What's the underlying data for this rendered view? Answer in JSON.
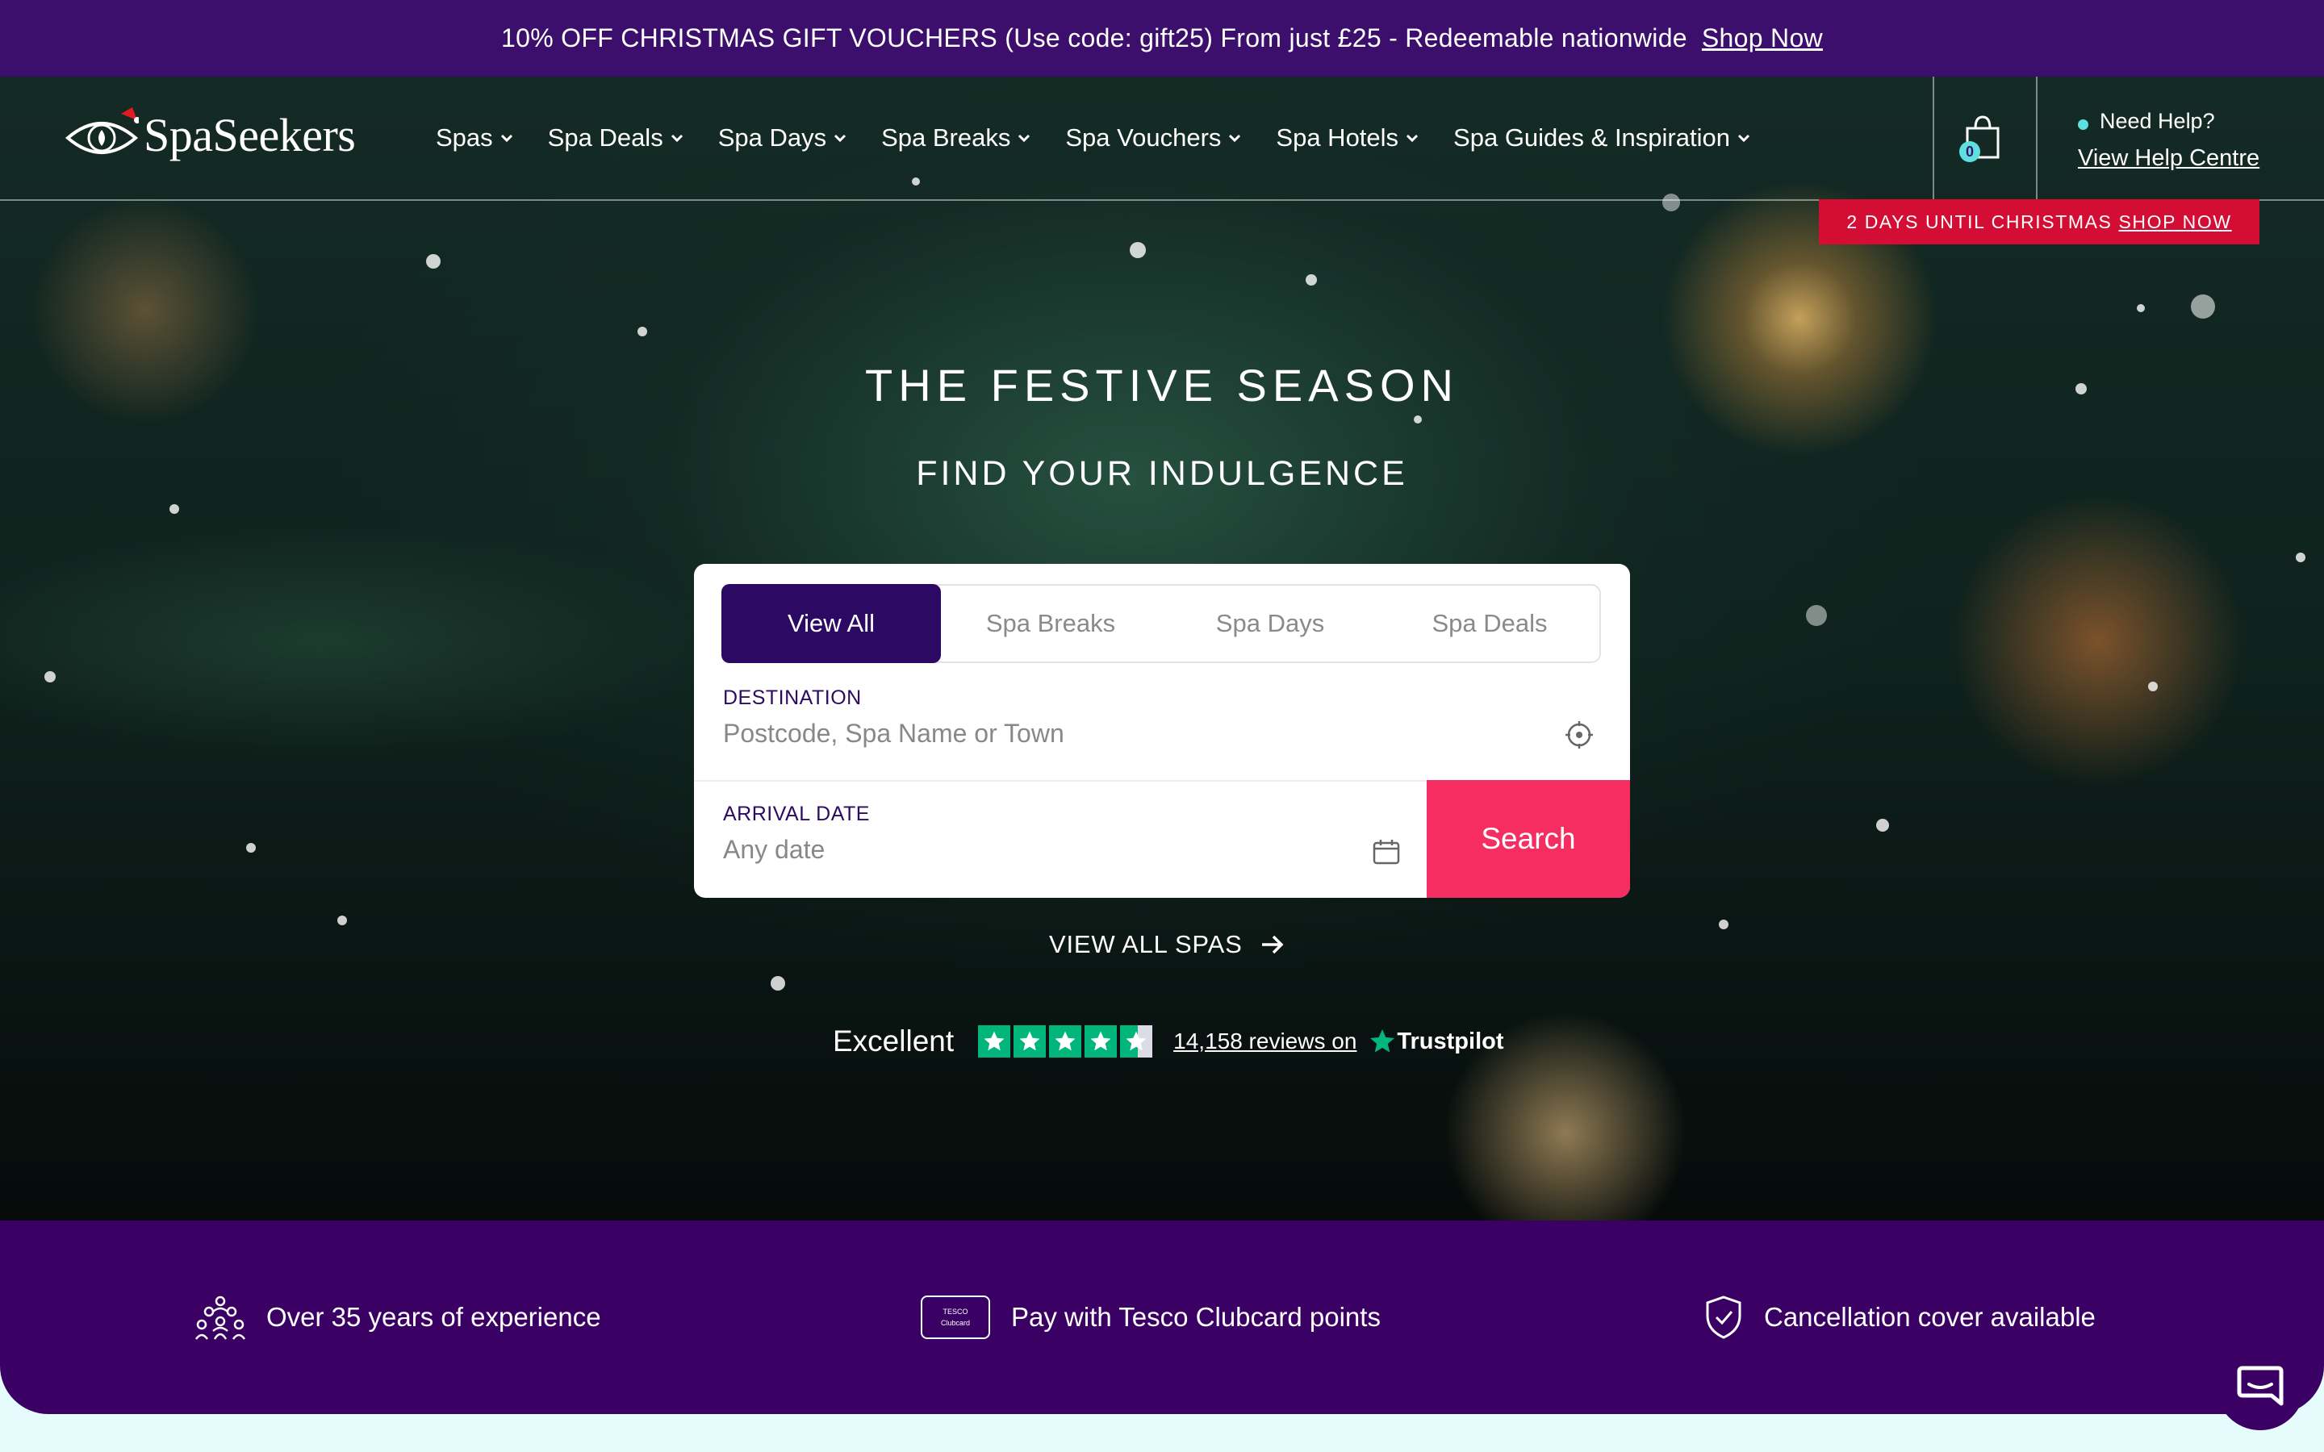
{
  "promo": {
    "text": "10% OFF CHRISTMAS GIFT VOUCHERS (Use code: gift25) From just £25 - Redeemable nationwide",
    "link": "Shop Now"
  },
  "header": {
    "logo": "SpaSeekers",
    "nav": [
      "Spas",
      "Spa Deals",
      "Spa Days",
      "Spa Breaks",
      "Spa Vouchers",
      "Spa Hotels",
      "Spa Guides & Inspiration"
    ],
    "cart_count": "0",
    "help_label": "Need Help?",
    "help_link": "View Help Centre"
  },
  "badge": {
    "text": "2 DAYS UNTIL CHRISTMAS",
    "link": "SHOP NOW"
  },
  "hero": {
    "title": "THE FESTIVE SEASON",
    "subtitle": "FIND YOUR INDULGENCE"
  },
  "search": {
    "tabs": [
      "View All",
      "Spa Breaks",
      "Spa Days",
      "Spa Deals"
    ],
    "active_tab": "View All",
    "destination_label": "DESTINATION",
    "destination_placeholder": "Postcode, Spa Name or Town",
    "arrival_label": "ARRIVAL DATE",
    "arrival_placeholder": "Any date",
    "button": "Search"
  },
  "view_all": "VIEW ALL SPAS",
  "trustpilot": {
    "rating_text": "Excellent",
    "stars": 4.5,
    "reviews": "14,158 reviews on",
    "brand": "Trustpilot"
  },
  "usp": [
    {
      "icon": "people-icon",
      "text": "Over 35 years of experience"
    },
    {
      "icon": "tesco-clubcard-icon",
      "text": "Pay with Tesco Clubcard points",
      "card_line1": "TESCO",
      "card_line2": "Clubcard"
    },
    {
      "icon": "shield-check-icon",
      "text": "Cancellation cover available"
    }
  ],
  "colors": {
    "brand_purple": "#3b0f6b",
    "accent_pink": "#f52d60",
    "badge_red": "#d40d35",
    "trustpilot_green": "#00b67a"
  }
}
